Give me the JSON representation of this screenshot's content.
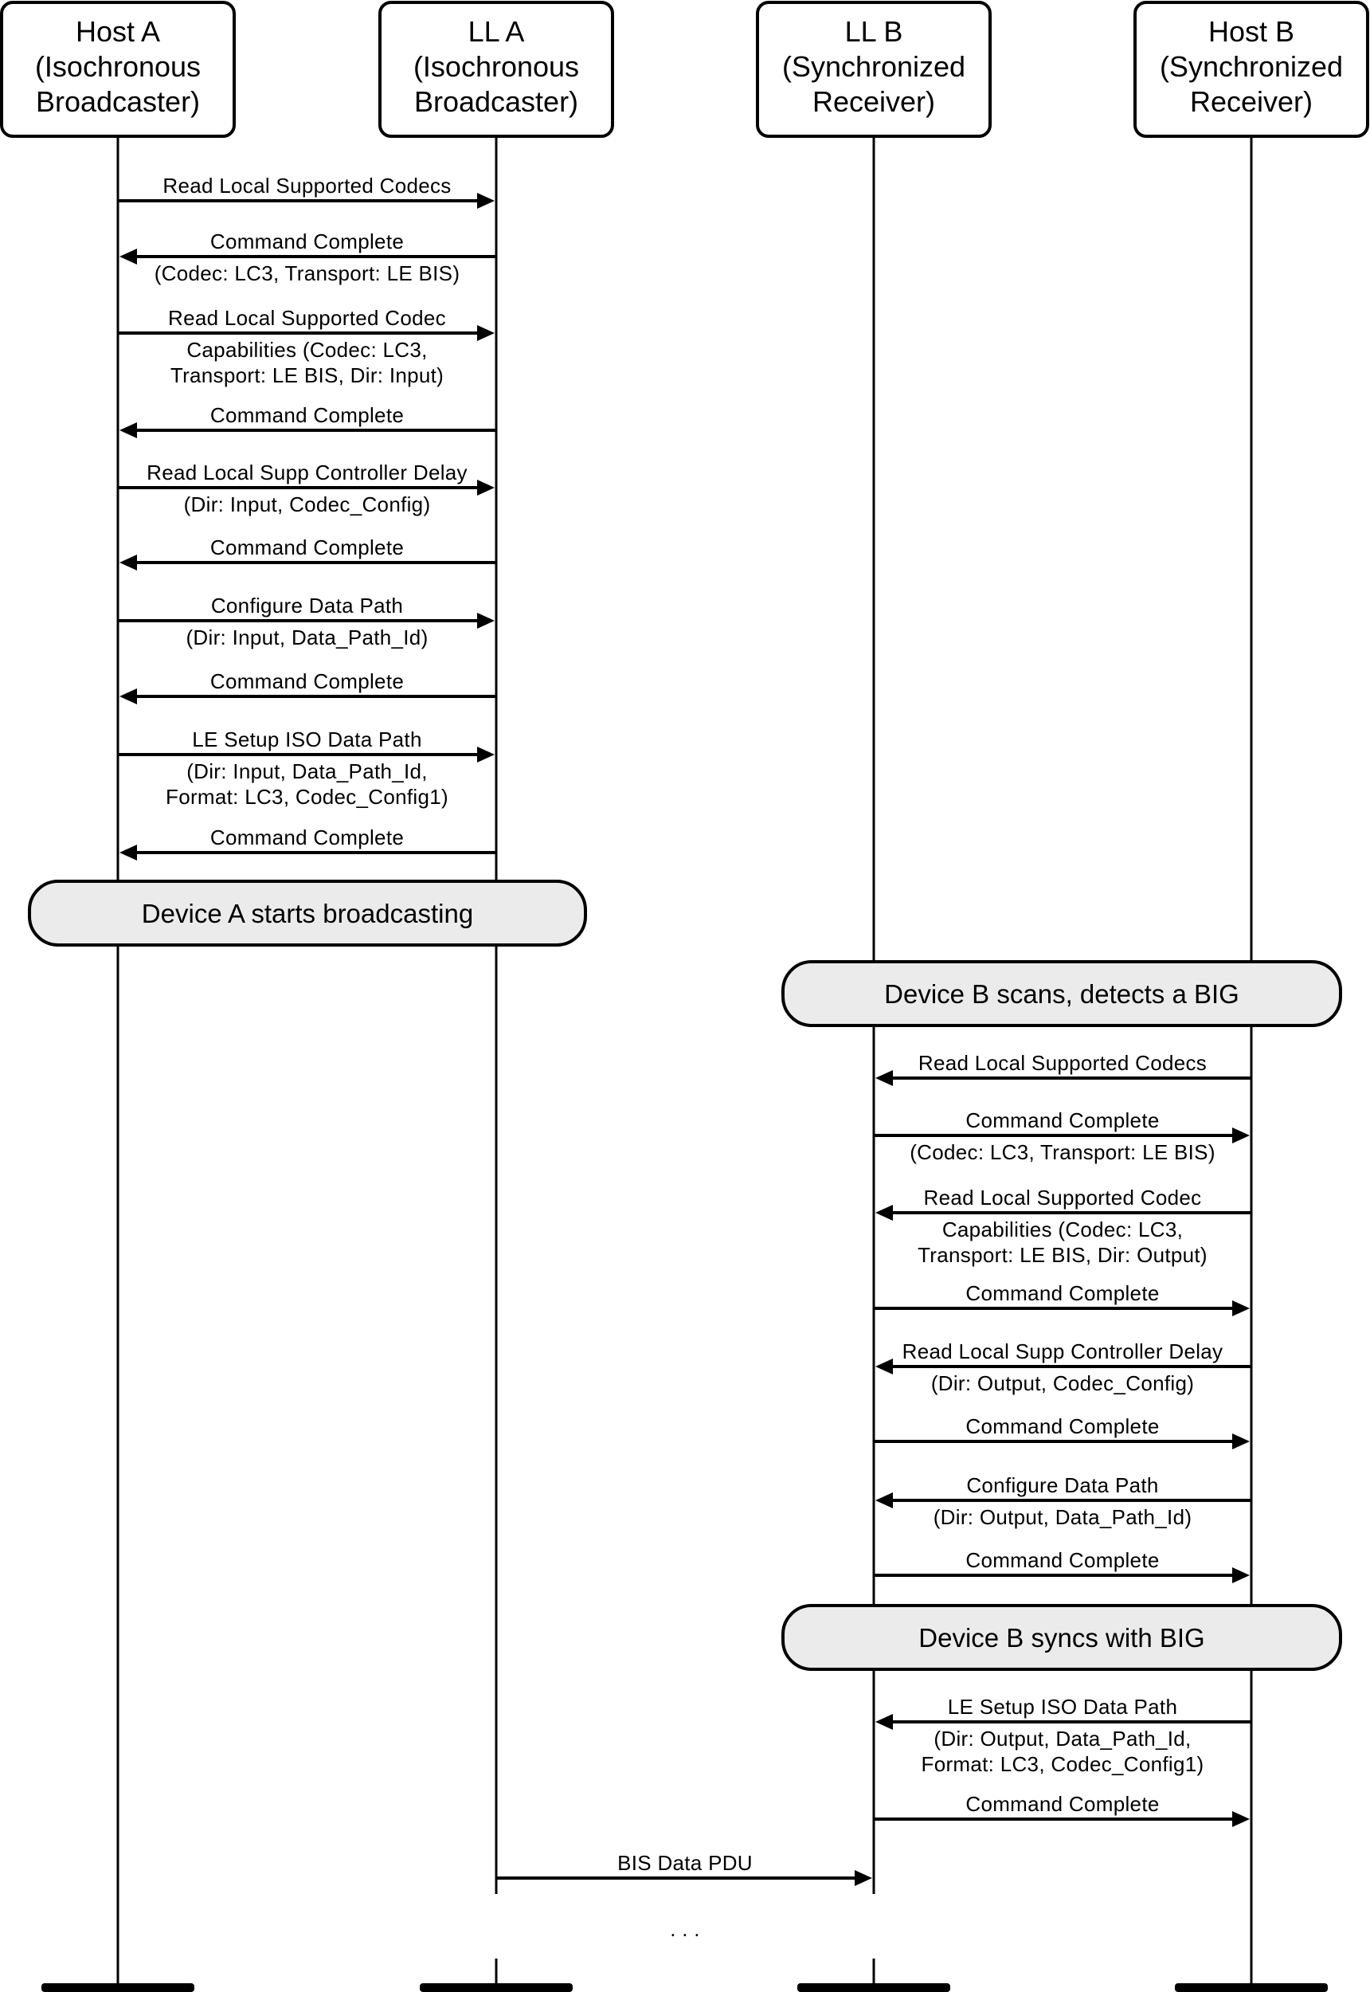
{
  "participants": [
    {
      "id": "host_a",
      "lines": [
        "Host A",
        "(Isochronous",
        "Broadcaster)"
      ]
    },
    {
      "id": "ll_a",
      "lines": [
        "LL A",
        "(Isochronous",
        "Broadcaster)"
      ]
    },
    {
      "id": "ll_b",
      "lines": [
        "LL B",
        "(Synchronized",
        "Receiver)"
      ]
    },
    {
      "id": "host_b",
      "lines": [
        "Host B",
        "(Synchronized",
        "Receiver)"
      ]
    }
  ],
  "messages": [
    {
      "from": "host_a",
      "to": "ll_a",
      "above": [
        "Read Local Supported Codecs"
      ],
      "below": []
    },
    {
      "from": "ll_a",
      "to": "host_a",
      "above": [
        "Command Complete"
      ],
      "below": [
        "(Codec:  LC3, Transport:  LE BIS)"
      ]
    },
    {
      "from": "host_a",
      "to": "ll_a",
      "above": [
        "Read Local Supported Codec"
      ],
      "below": [
        "Capabilities (Codec:  LC3,",
        "Transport:  LE BIS, Dir:  Input)"
      ]
    },
    {
      "from": "ll_a",
      "to": "host_a",
      "above": [
        "Command Complete"
      ],
      "below": []
    },
    {
      "from": "host_a",
      "to": "ll_a",
      "above": [
        "Read Local Supp Controller Delay"
      ],
      "below": [
        "(Dir:  Input, Codec_Config)"
      ]
    },
    {
      "from": "ll_a",
      "to": "host_a",
      "above": [
        "Command Complete"
      ],
      "below": []
    },
    {
      "from": "host_a",
      "to": "ll_a",
      "above": [
        "Configure Data Path"
      ],
      "below": [
        "(Dir:  Input, Data_Path_Id)"
      ]
    },
    {
      "from": "ll_a",
      "to": "host_a",
      "above": [
        "Command Complete"
      ],
      "below": []
    },
    {
      "from": "host_a",
      "to": "ll_a",
      "above": [
        "LE Setup ISO Data Path"
      ],
      "below": [
        "(Dir:  Input, Data_Path_Id,",
        "Format:  LC3, Codec_Config1)"
      ]
    },
    {
      "from": "ll_a",
      "to": "host_a",
      "above": [
        "Command Complete"
      ],
      "below": []
    },
    {
      "from": "host_b",
      "to": "ll_b",
      "above": [
        "Read Local Supported Codecs"
      ],
      "below": []
    },
    {
      "from": "ll_b",
      "to": "host_b",
      "above": [
        "Command Complete"
      ],
      "below": [
        "(Codec:  LC3, Transport:  LE BIS)"
      ]
    },
    {
      "from": "host_b",
      "to": "ll_b",
      "above": [
        "Read Local Supported Codec"
      ],
      "below": [
        "Capabilities (Codec:  LC3,",
        "Transport:  LE BIS, Dir:  Output)"
      ]
    },
    {
      "from": "ll_b",
      "to": "host_b",
      "above": [
        "Command Complete"
      ],
      "below": []
    },
    {
      "from": "host_b",
      "to": "ll_b",
      "above": [
        "Read Local Supp Controller Delay"
      ],
      "below": [
        "(Dir:  Output, Codec_Config)"
      ]
    },
    {
      "from": "ll_b",
      "to": "host_b",
      "above": [
        "Command Complete"
      ],
      "below": []
    },
    {
      "from": "host_b",
      "to": "ll_b",
      "above": [
        "Configure Data Path"
      ],
      "below": [
        "(Dir:  Output, Data_Path_Id)"
      ]
    },
    {
      "from": "ll_b",
      "to": "host_b",
      "above": [
        "Command Complete"
      ],
      "below": []
    },
    {
      "from": "host_b",
      "to": "ll_b",
      "above": [
        "LE Setup ISO Data Path"
      ],
      "below": [
        "(Dir:  Output, Data_Path_Id,",
        "Format:  LC3, Codec_Config1)"
      ]
    },
    {
      "from": "ll_b",
      "to": "host_b",
      "above": [
        "Command Complete"
      ],
      "below": []
    },
    {
      "from": "ll_a",
      "to": "ll_b",
      "above": [
        "BIS Data PDU"
      ],
      "below": []
    }
  ],
  "banners": [
    {
      "text": "Device A starts broadcasting",
      "span": [
        "host_a",
        "ll_a"
      ]
    },
    {
      "text": "Device B scans, detects a BIG",
      "span": [
        "ll_b",
        "host_b"
      ]
    },
    {
      "text": "Device B syncs with BIG",
      "span": [
        "ll_b",
        "host_b"
      ]
    }
  ],
  "continuation": ". . .",
  "colors": {
    "line": "#000000",
    "banner_fill": "#ebebeb",
    "background": "#ffffff"
  }
}
